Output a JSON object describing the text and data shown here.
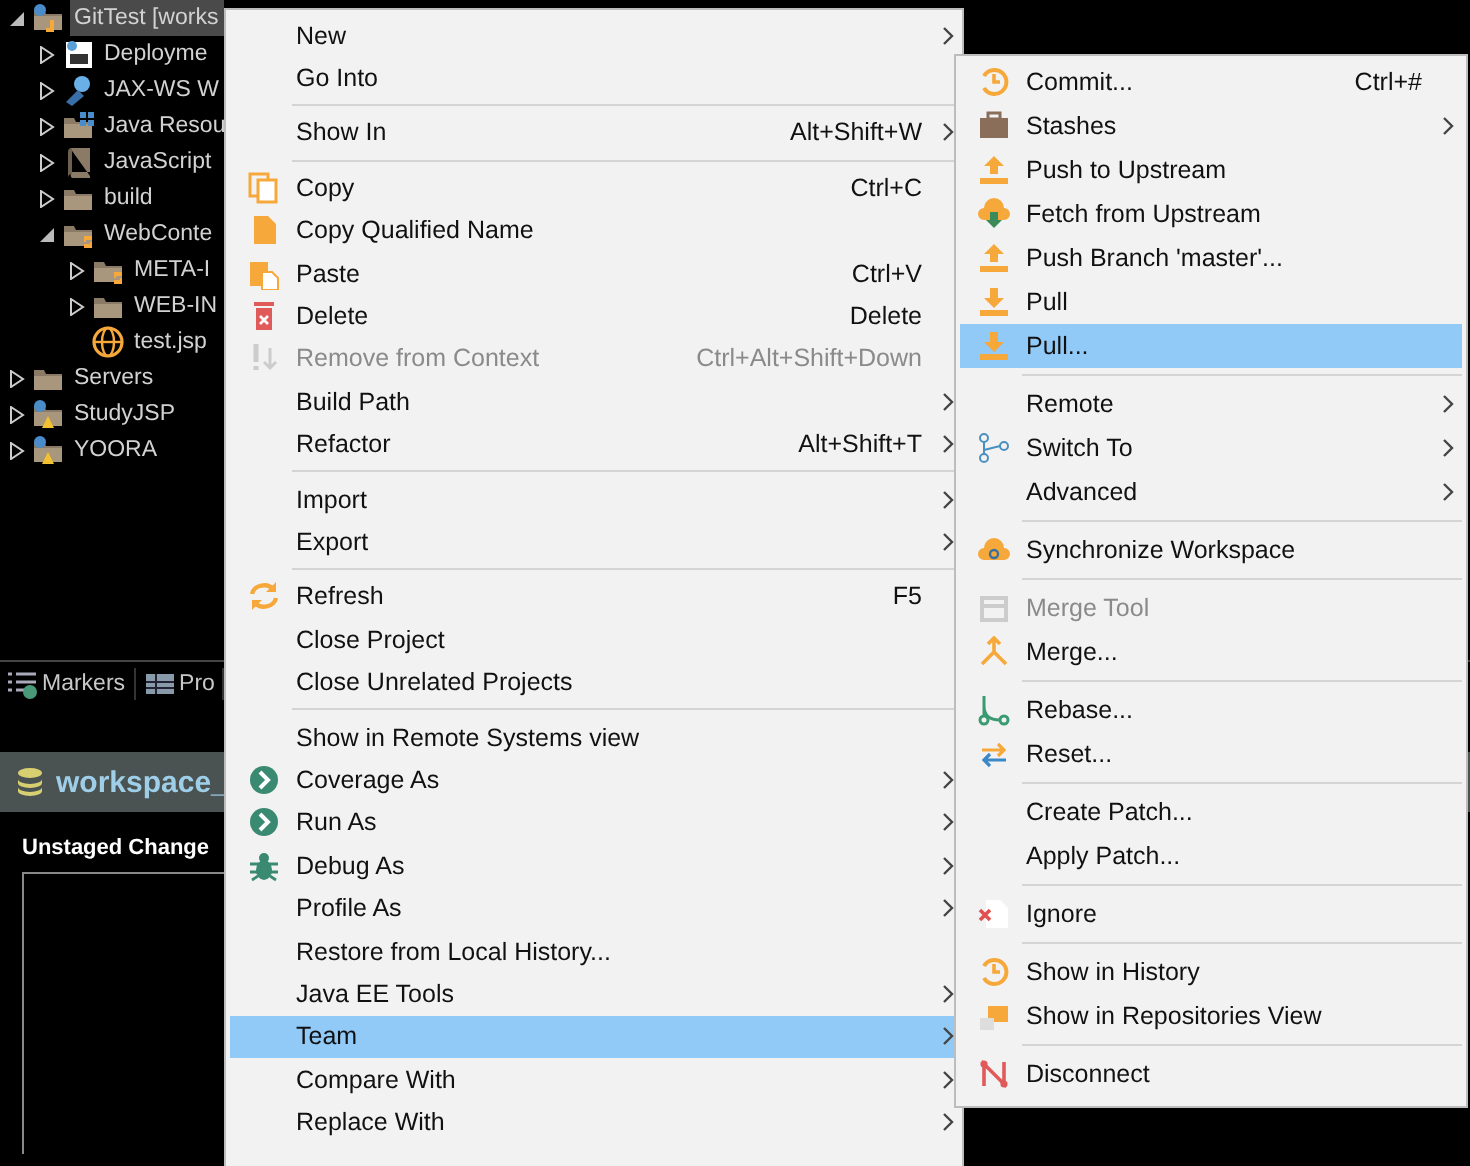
{
  "tree": [
    {
      "label": "GitTest [works",
      "kind": "project",
      "expanded": true,
      "selected": true,
      "children": [
        {
          "label": "Deployme",
          "kind": "descriptor",
          "expanded": false,
          "selected": false
        },
        {
          "label": "JAX-WS W",
          "kind": "service",
          "expanded": false,
          "selected": false
        },
        {
          "label": "Java Resou",
          "kind": "resources",
          "expanded": false,
          "selected": false
        },
        {
          "label": "JavaScript",
          "kind": "book",
          "expanded": false,
          "selected": false
        },
        {
          "label": "build",
          "kind": "folder",
          "expanded": false,
          "selected": false
        },
        {
          "label": "WebConte",
          "kind": "gitfolder",
          "expanded": true,
          "selected": false,
          "children": [
            {
              "label": "META-I",
              "kind": "gitfolder",
              "expanded": false,
              "selected": false
            },
            {
              "label": "WEB-IN",
              "kind": "folder",
              "expanded": false,
              "selected": false
            },
            {
              "label": "test.jsp",
              "kind": "web",
              "selected": false
            }
          ]
        }
      ]
    },
    {
      "label": "Servers",
      "kind": "folder",
      "expanded": false,
      "selected": false
    },
    {
      "label": "StudyJSP",
      "kind": "warnproject",
      "expanded": false,
      "selected": false
    },
    {
      "label": "YOORA",
      "kind": "warnproject",
      "expanded": false,
      "selected": false
    }
  ],
  "bottom_tabs": [
    {
      "label": "Markers"
    },
    {
      "label": "Pro"
    }
  ],
  "staging": {
    "title": "workspace_",
    "section": "Unstaged Change"
  },
  "context_menu": [
    {
      "kind": "item",
      "label": "New",
      "submenu": true,
      "disabled": false,
      "selected": false
    },
    {
      "kind": "item",
      "label": "Go Into",
      "submenu": false,
      "disabled": false,
      "selected": false
    },
    {
      "kind": "separator"
    },
    {
      "kind": "item",
      "label": "Show In",
      "shortcut": "Alt+Shift+W",
      "submenu": true,
      "disabled": false,
      "selected": false
    },
    {
      "kind": "separator"
    },
    {
      "kind": "item",
      "label": "Copy",
      "shortcut": "Ctrl+C",
      "submenu": false,
      "disabled": false,
      "selected": false
    },
    {
      "kind": "item",
      "label": "Copy Qualified Name",
      "submenu": false,
      "disabled": false,
      "selected": false
    },
    {
      "kind": "item",
      "label": "Paste",
      "shortcut": "Ctrl+V",
      "submenu": false,
      "disabled": false,
      "selected": false
    },
    {
      "kind": "item",
      "label": "Delete",
      "shortcut": "Delete",
      "submenu": false,
      "disabled": false,
      "selected": false
    },
    {
      "kind": "item",
      "label": "Remove from Context",
      "shortcut": "Ctrl+Alt+Shift+Down",
      "submenu": false,
      "disabled": true,
      "selected": false
    },
    {
      "kind": "item",
      "label": "Build Path",
      "submenu": true,
      "disabled": false,
      "selected": false
    },
    {
      "kind": "item",
      "label": "Refactor",
      "shortcut": "Alt+Shift+T",
      "submenu": true,
      "disabled": false,
      "selected": false
    },
    {
      "kind": "separator"
    },
    {
      "kind": "item",
      "label": "Import",
      "submenu": true,
      "disabled": false,
      "selected": false
    },
    {
      "kind": "item",
      "label": "Export",
      "submenu": true,
      "disabled": false,
      "selected": false
    },
    {
      "kind": "separator"
    },
    {
      "kind": "item",
      "label": "Refresh",
      "shortcut": "F5",
      "submenu": false,
      "disabled": false,
      "selected": false
    },
    {
      "kind": "item",
      "label": "Close Project",
      "submenu": false,
      "disabled": false,
      "selected": false
    },
    {
      "kind": "item",
      "label": "Close Unrelated Projects",
      "submenu": false,
      "disabled": false,
      "selected": false
    },
    {
      "kind": "separator"
    },
    {
      "kind": "item",
      "label": "Show in Remote Systems view",
      "submenu": false,
      "disabled": false,
      "selected": false
    },
    {
      "kind": "item",
      "label": "Coverage As",
      "submenu": true,
      "disabled": false,
      "selected": false
    },
    {
      "kind": "item",
      "label": "Run As",
      "submenu": true,
      "disabled": false,
      "selected": false
    },
    {
      "kind": "item",
      "label": "Debug As",
      "submenu": true,
      "disabled": false,
      "selected": false
    },
    {
      "kind": "item",
      "label": "Profile As",
      "submenu": true,
      "disabled": false,
      "selected": false
    },
    {
      "kind": "item",
      "label": "Restore from Local History...",
      "submenu": false,
      "disabled": false,
      "selected": false
    },
    {
      "kind": "item",
      "label": "Java EE Tools",
      "submenu": true,
      "disabled": false,
      "selected": false
    },
    {
      "kind": "item",
      "label": "Team",
      "submenu": true,
      "disabled": false,
      "selected": true
    },
    {
      "kind": "item",
      "label": "Compare With",
      "submenu": true,
      "disabled": false,
      "selected": false
    },
    {
      "kind": "item",
      "label": "Replace With",
      "submenu": true,
      "disabled": false,
      "selected": false
    }
  ],
  "team_submenu": [
    {
      "kind": "item",
      "label": "Commit...",
      "shortcut": "Ctrl+#",
      "submenu": false,
      "disabled": false,
      "selected": false
    },
    {
      "kind": "item",
      "label": "Stashes",
      "submenu": true,
      "disabled": false,
      "selected": false
    },
    {
      "kind": "item",
      "label": "Push to Upstream",
      "submenu": false,
      "disabled": false,
      "selected": false
    },
    {
      "kind": "item",
      "label": "Fetch from Upstream",
      "submenu": false,
      "disabled": false,
      "selected": false
    },
    {
      "kind": "item",
      "label": "Push Branch 'master'...",
      "submenu": false,
      "disabled": false,
      "selected": false
    },
    {
      "kind": "item",
      "label": "Pull",
      "submenu": false,
      "disabled": false,
      "selected": false
    },
    {
      "kind": "item",
      "label": "Pull...",
      "submenu": false,
      "disabled": false,
      "selected": true
    },
    {
      "kind": "separator"
    },
    {
      "kind": "item",
      "label": "Remote",
      "submenu": true,
      "disabled": false,
      "selected": false
    },
    {
      "kind": "item",
      "label": "Switch To",
      "submenu": true,
      "disabled": false,
      "selected": false
    },
    {
      "kind": "item",
      "label": "Advanced",
      "submenu": true,
      "disabled": false,
      "selected": false
    },
    {
      "kind": "separator"
    },
    {
      "kind": "item",
      "label": "Synchronize Workspace",
      "submenu": false,
      "disabled": false,
      "selected": false
    },
    {
      "kind": "separator"
    },
    {
      "kind": "item",
      "label": "Merge Tool",
      "submenu": false,
      "disabled": true,
      "selected": false
    },
    {
      "kind": "item",
      "label": "Merge...",
      "submenu": false,
      "disabled": false,
      "selected": false
    },
    {
      "kind": "separator"
    },
    {
      "kind": "item",
      "label": "Rebase...",
      "submenu": false,
      "disabled": false,
      "selected": false
    },
    {
      "kind": "item",
      "label": "Reset...",
      "submenu": false,
      "disabled": false,
      "selected": false
    },
    {
      "kind": "separator"
    },
    {
      "kind": "item",
      "label": "Create Patch...",
      "submenu": false,
      "disabled": false,
      "selected": false
    },
    {
      "kind": "item",
      "label": "Apply Patch...",
      "submenu": false,
      "disabled": false,
      "selected": false
    },
    {
      "kind": "separator"
    },
    {
      "kind": "item",
      "label": "Ignore",
      "submenu": false,
      "disabled": false,
      "selected": false
    },
    {
      "kind": "separator"
    },
    {
      "kind": "item",
      "label": "Show in History",
      "submenu": false,
      "disabled": false,
      "selected": false
    },
    {
      "kind": "item",
      "label": "Show in Repositories View",
      "submenu": false,
      "disabled": false,
      "selected": false
    },
    {
      "kind": "separator"
    },
    {
      "kind": "item",
      "label": "Disconnect",
      "submenu": false,
      "disabled": false,
      "selected": false
    }
  ]
}
